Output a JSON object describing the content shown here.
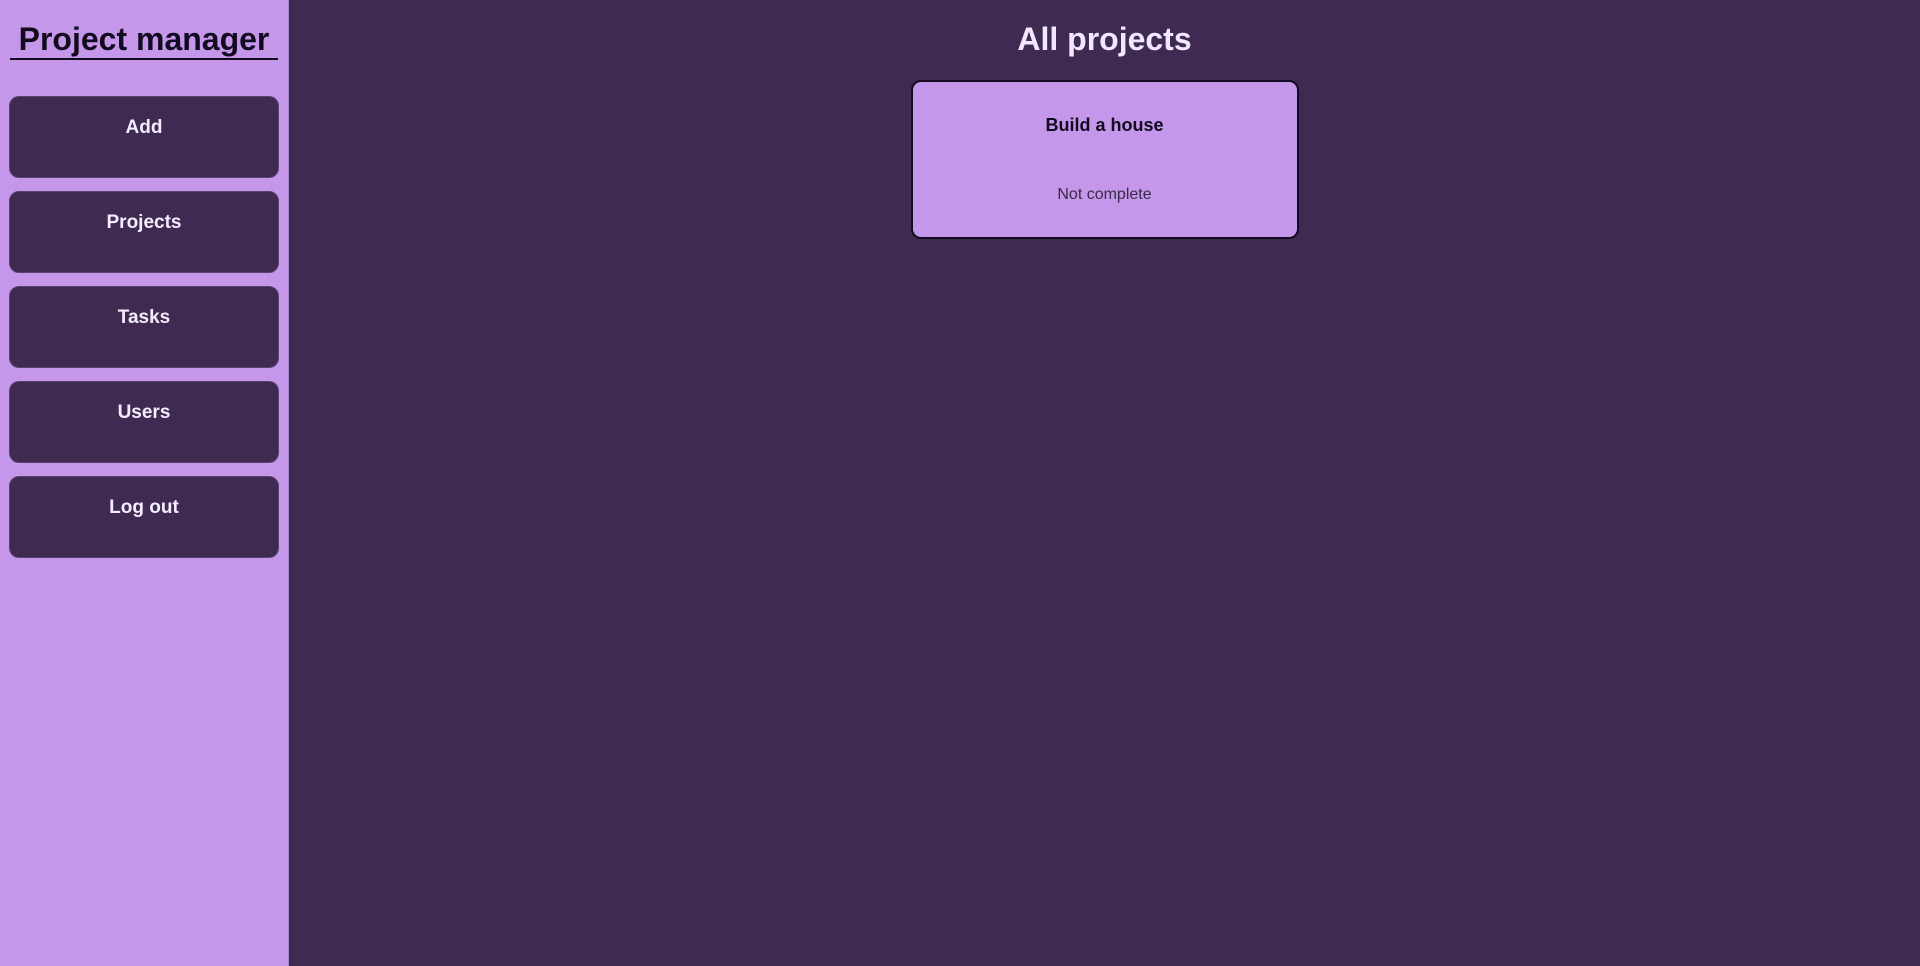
{
  "sidebar": {
    "title": "Project manager",
    "items": [
      {
        "label": "Add"
      },
      {
        "label": "Projects"
      },
      {
        "label": "Tasks"
      },
      {
        "label": "Users"
      },
      {
        "label": "Log out"
      }
    ]
  },
  "main": {
    "title": "All projects",
    "projects": [
      {
        "name": "Build a house",
        "status": "Not complete"
      }
    ]
  },
  "colors": {
    "sidebar_bg": "#c597ea",
    "main_bg": "#3f2b51",
    "button_bg": "#3f2b51",
    "card_bg": "#c597ea",
    "text_light": "#f4ecff",
    "text_dark": "#120a1e"
  }
}
